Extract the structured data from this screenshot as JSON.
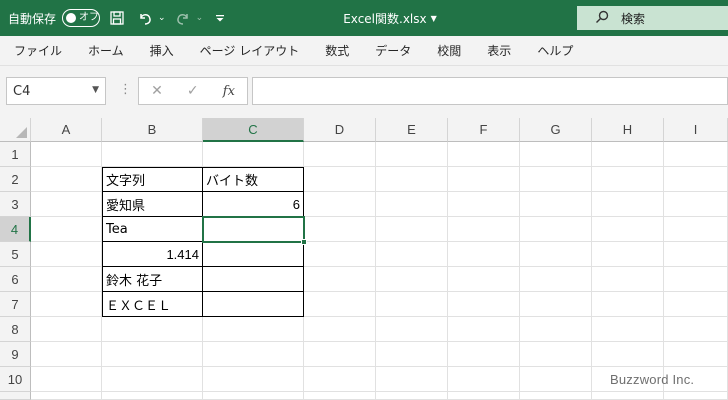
{
  "titlebar": {
    "autosave_label": "自動保存",
    "autosave_state": "オフ",
    "doc_title": "Excel関数.xlsx",
    "search_label": "検索"
  },
  "ribbon": {
    "tabs": [
      "ファイル",
      "ホーム",
      "挿入",
      "ページ レイアウト",
      "数式",
      "データ",
      "校閲",
      "表示",
      "ヘルプ"
    ]
  },
  "formula_bar": {
    "name_box": "C4",
    "formula": ""
  },
  "sheet": {
    "columns": [
      "A",
      "B",
      "C",
      "D",
      "E",
      "F",
      "G",
      "H",
      "I"
    ],
    "rows": [
      "1",
      "2",
      "3",
      "4",
      "5",
      "6",
      "7",
      "8",
      "9",
      "10"
    ],
    "active_cell": "C4",
    "table": [
      {
        "b": "文字列",
        "c": "バイト数"
      },
      {
        "b": "愛知県",
        "c": "6"
      },
      {
        "b": "Tea",
        "c": ""
      },
      {
        "b": "1.414",
        "c": ""
      },
      {
        "b": "鈴木 花子",
        "c": ""
      },
      {
        "b": "ＥＸＣＥＬ",
        "c": ""
      }
    ]
  },
  "watermark": "Buzzword Inc.",
  "colors": {
    "accent": "#217346",
    "search_bg": "#c9e3d2",
    "ribbon_bg": "#f3f3f3"
  }
}
